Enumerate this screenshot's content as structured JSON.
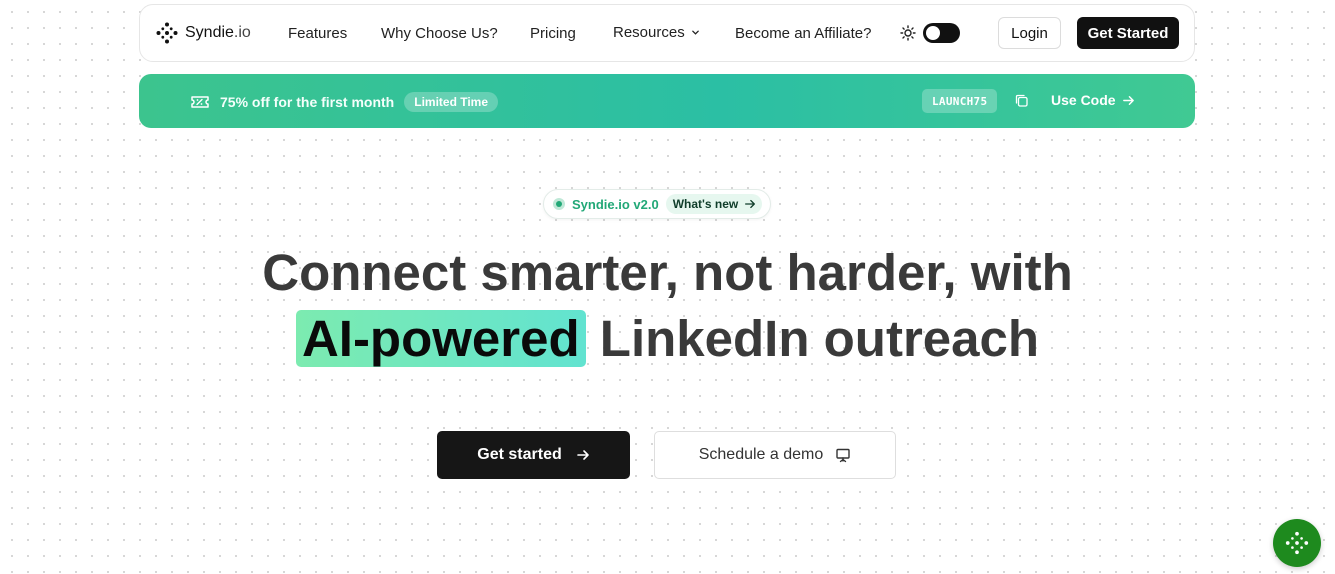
{
  "colors": {
    "accent_green": "#22a877",
    "promo_gradient_start": "#3cc48e",
    "promo_gradient_mid": "#2bbfa4",
    "highlight_start": "#7cebb0",
    "highlight_end": "#62e3d0",
    "dark": "#161616",
    "fab": "#1e8a1e"
  },
  "navbar": {
    "brand": {
      "name": "Syndie",
      "tld": ".io",
      "icon": "syndie-logo-icon"
    },
    "links": [
      "Features",
      "Why Choose Us?",
      "Pricing",
      "Resources",
      "Become an Affiliate?"
    ],
    "resources_icon": "chevron-down-icon",
    "theme": {
      "icon": "sun-icon",
      "dark_mode": true
    },
    "login_label": "Login",
    "get_started_label": "Get Started"
  },
  "promo": {
    "icon": "ticket-icon",
    "text": "75% off for the first month",
    "badge": "Limited Time",
    "code": "LAUNCH75",
    "copy_icon": "copy-icon",
    "use_code_label": "Use Code",
    "use_code_icon": "arrow-right-icon"
  },
  "version_pill": {
    "label": "Syndie.io v2.0",
    "whats_new": "What's new",
    "icon": "arrow-right-icon"
  },
  "hero": {
    "line1": "Connect smarter, not harder, with",
    "highlight": "AI-powered",
    "line2_rest": " LinkedIn outreach",
    "primary_cta": "Get started",
    "primary_icon": "arrow-right-icon",
    "secondary_cta": "Schedule a demo",
    "secondary_icon": "presentation-icon"
  },
  "fab": {
    "icon": "syndie-logo-icon"
  }
}
